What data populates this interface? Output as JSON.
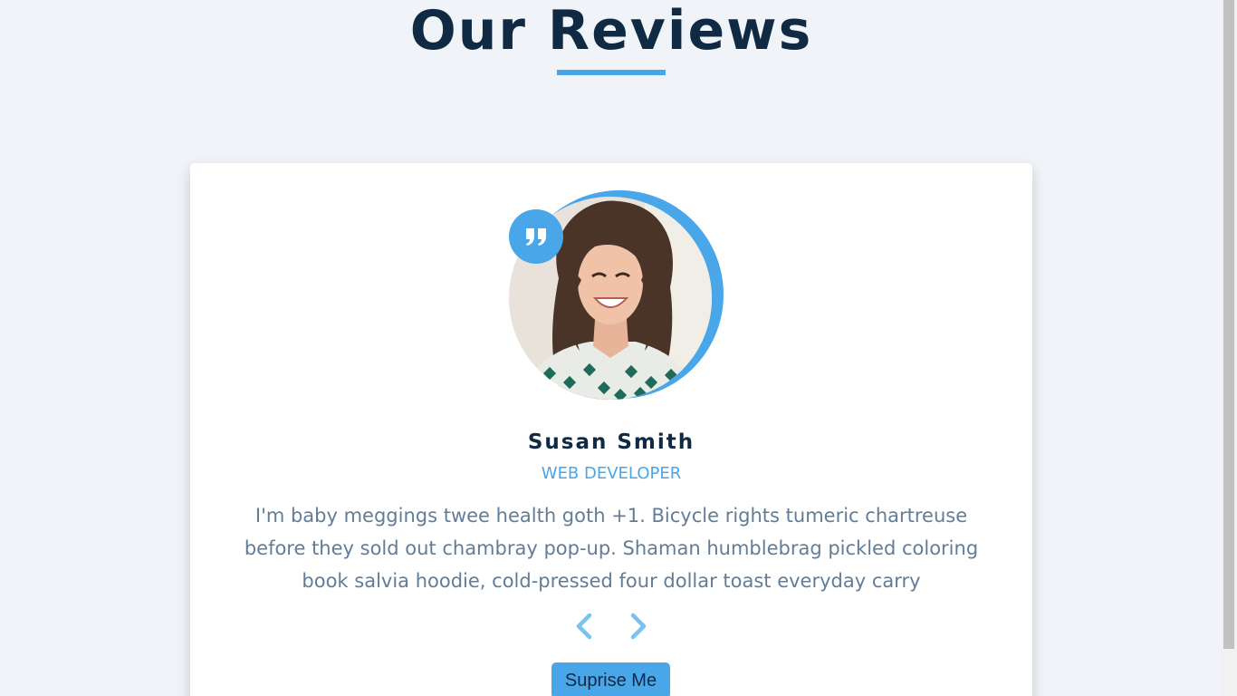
{
  "section": {
    "title": "Our Reviews",
    "accent_color": "#49a6e9",
    "title_color": "#102a43"
  },
  "review": {
    "author": "Susan Smith",
    "job": "WEB DEVELOPER",
    "text": "I'm baby meggings twee health goth +1. Bicycle rights tumeric chartreuse before they sold out chambray pop-up. Shaman humblebrag pickled coloring book salvia hoodie, cold-pressed four dollar toast everyday carry",
    "avatar_icon": "person-photo",
    "quote_icon": "quote-right-icon"
  },
  "controls": {
    "prev_icon": "chevron-left-icon",
    "next_icon": "chevron-right-icon",
    "random_label": "Suprise Me"
  }
}
